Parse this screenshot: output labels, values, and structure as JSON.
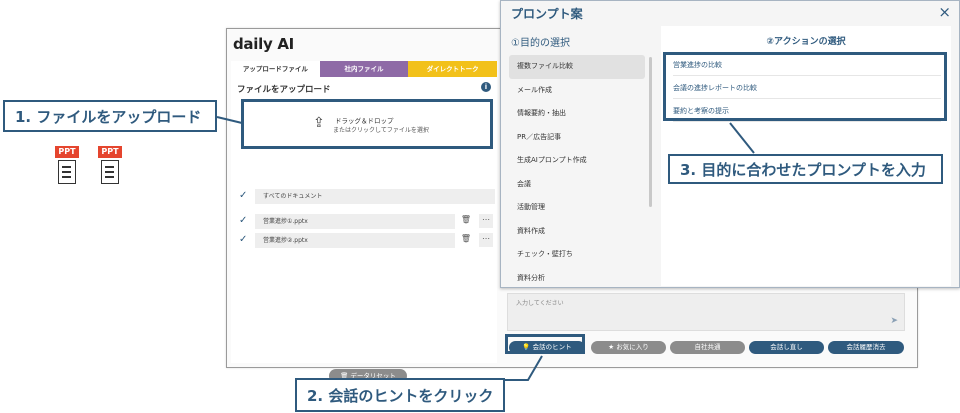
{
  "callouts": {
    "step1": "1. ファイルをアップロード",
    "step2": "2. 会話のヒントをクリック",
    "step3": "3. 目的に合わせたプロンプトを入力"
  },
  "file_icons": [
    {
      "tag": "PPT",
      "icon": "document-icon"
    },
    {
      "tag": "PPT",
      "icon": "document-icon"
    }
  ],
  "app": {
    "logo": "daily AI",
    "tabs": [
      "アップロードファイル",
      "社内ファイル",
      "ダイレクトトーク"
    ],
    "upload_title": "ファイルをアップロード",
    "info_icon": "i",
    "dropzone": {
      "icon": "upload-icon",
      "line1": "ドラッグ＆ドロップ",
      "line2": "またはクリックしてファイルを選択"
    },
    "all_docs": "すべてのドキュメント",
    "files": [
      "営業進捗①.pptx",
      "営業進捗②.pptx"
    ],
    "reset_button": "データリセット",
    "input_placeholder": "入力してください",
    "buttons": {
      "hint": "会話のヒント",
      "favorite": "お気に入り",
      "company": "自社共通",
      "redo": "会話し直し",
      "clear_history": "会話履歴消去"
    }
  },
  "popup": {
    "title": "プロンプト案",
    "close": "×",
    "purpose_title": "①目的の選択",
    "purposes": [
      "複数ファイル比較",
      "メール作成",
      "情報要約・抽出",
      "PR／広告記事",
      "生成AIプロンプト作成",
      "会議",
      "活動管理",
      "資料作成",
      "チェック・壁打ち",
      "資料分析"
    ],
    "selected_purpose": 0,
    "action_title": "②アクションの選択",
    "actions": [
      "営業進捗の比較",
      "会議の進捗レポートの比較",
      "要約と考察の提示"
    ]
  },
  "colors": {
    "accent": "#2f5a7e",
    "tab_purple": "#8e6aa6",
    "tab_yellow": "#f2c11a",
    "ppt_red": "#e5452e",
    "button_grey": "#8c8c8c"
  }
}
